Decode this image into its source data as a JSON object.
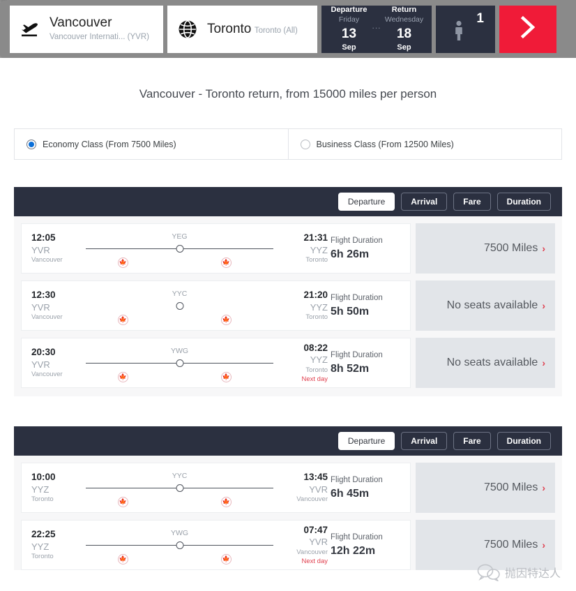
{
  "header": {
    "origin": {
      "icon": "plane-takeoff-icon",
      "name": "Vancouver",
      "sub": "Vancouver Internati... (YVR)"
    },
    "destination": {
      "icon": "globe-icon",
      "name": "Toronto",
      "sub": "Toronto (All)"
    },
    "dates": {
      "departure_label": "Departure",
      "departure_day": "Friday",
      "departure_num": "13",
      "departure_month": "Sep",
      "separator": "...",
      "return_label": "Return",
      "return_day": "Wednesday",
      "return_num": "18",
      "return_month": "Sep"
    },
    "passengers": {
      "count": "1",
      "icon": "person-icon"
    },
    "submit": {
      "icon": "chevron-right-icon"
    },
    "accent_red": "#f01b38",
    "dark": "#2b3040"
  },
  "page_title": "Vancouver - Toronto return, from 15000 miles per person",
  "cabin_classes": [
    {
      "label": "Economy Class (From 7500 Miles)",
      "selected": true
    },
    {
      "label": "Business Class (From 12500 Miles)",
      "selected": false
    }
  ],
  "sort_tabs": [
    {
      "label": "Departure",
      "active": true
    },
    {
      "label": "Arrival",
      "active": false
    },
    {
      "label": "Fare",
      "active": false
    },
    {
      "label": "Duration",
      "active": false
    }
  ],
  "duration_label": "Flight Duration",
  "outbound": {
    "flights": [
      {
        "depart_time": "12:05",
        "depart_code": "YVR",
        "depart_city": "Vancouver",
        "arrive_time": "21:31",
        "arrive_code": "YYZ",
        "arrive_city": "Toronto",
        "next_day": "",
        "stop": "YEG",
        "has_line": true,
        "duration": "6h 26m",
        "price": "7500 Miles",
        "available": true
      },
      {
        "depart_time": "12:30",
        "depart_code": "YVR",
        "depart_city": "Vancouver",
        "arrive_time": "21:20",
        "arrive_code": "YYZ",
        "arrive_city": "Toronto",
        "next_day": "",
        "stop": "YYC",
        "has_line": false,
        "duration": "5h 50m",
        "price": "No seats available",
        "available": false
      },
      {
        "depart_time": "20:30",
        "depart_code": "YVR",
        "depart_city": "Vancouver",
        "arrive_time": "08:22",
        "arrive_code": "YYZ",
        "arrive_city": "Toronto",
        "next_day": "Next day",
        "stop": "YWG",
        "has_line": true,
        "duration": "8h 52m",
        "price": "No seats available",
        "available": false
      }
    ]
  },
  "inbound": {
    "flights": [
      {
        "depart_time": "10:00",
        "depart_code": "YYZ",
        "depart_city": "Toronto",
        "arrive_time": "13:45",
        "arrive_code": "YVR",
        "arrive_city": "Vancouver",
        "next_day": "",
        "stop": "YYC",
        "has_line": true,
        "duration": "6h 45m",
        "price": "7500 Miles",
        "available": true
      },
      {
        "depart_time": "22:25",
        "depart_code": "YYZ",
        "depart_city": "Toronto",
        "arrive_time": "07:47",
        "arrive_code": "YVR",
        "arrive_city": "Vancouver",
        "next_day": "Next day",
        "stop": "YWG",
        "has_line": true,
        "duration": "12h 22m",
        "price": "7500 Miles",
        "available": true
      }
    ]
  },
  "watermark": {
    "icon": "wechat-icon",
    "text": "抛因特达人"
  }
}
